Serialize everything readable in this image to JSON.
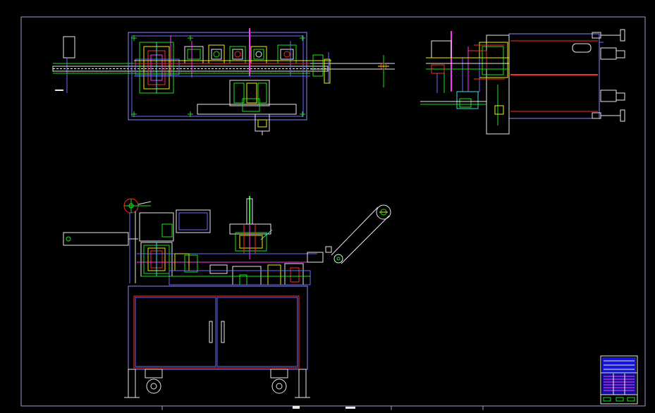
{
  "drawing": {
    "background": "#000000",
    "palette": {
      "frame": "#9aa0c8",
      "blue": "#6b6bff",
      "green": "#19e619",
      "yellow": "#f0f000",
      "red": "#ff2a2a",
      "magenta": "#ff33ff",
      "cyan": "#33e6e6",
      "white": "#e8e8e8",
      "title_block": "#1a1aff"
    },
    "views": [
      "top-view",
      "side-view",
      "front-elevation"
    ],
    "title_block": {
      "present": true,
      "content_legible": false
    }
  }
}
